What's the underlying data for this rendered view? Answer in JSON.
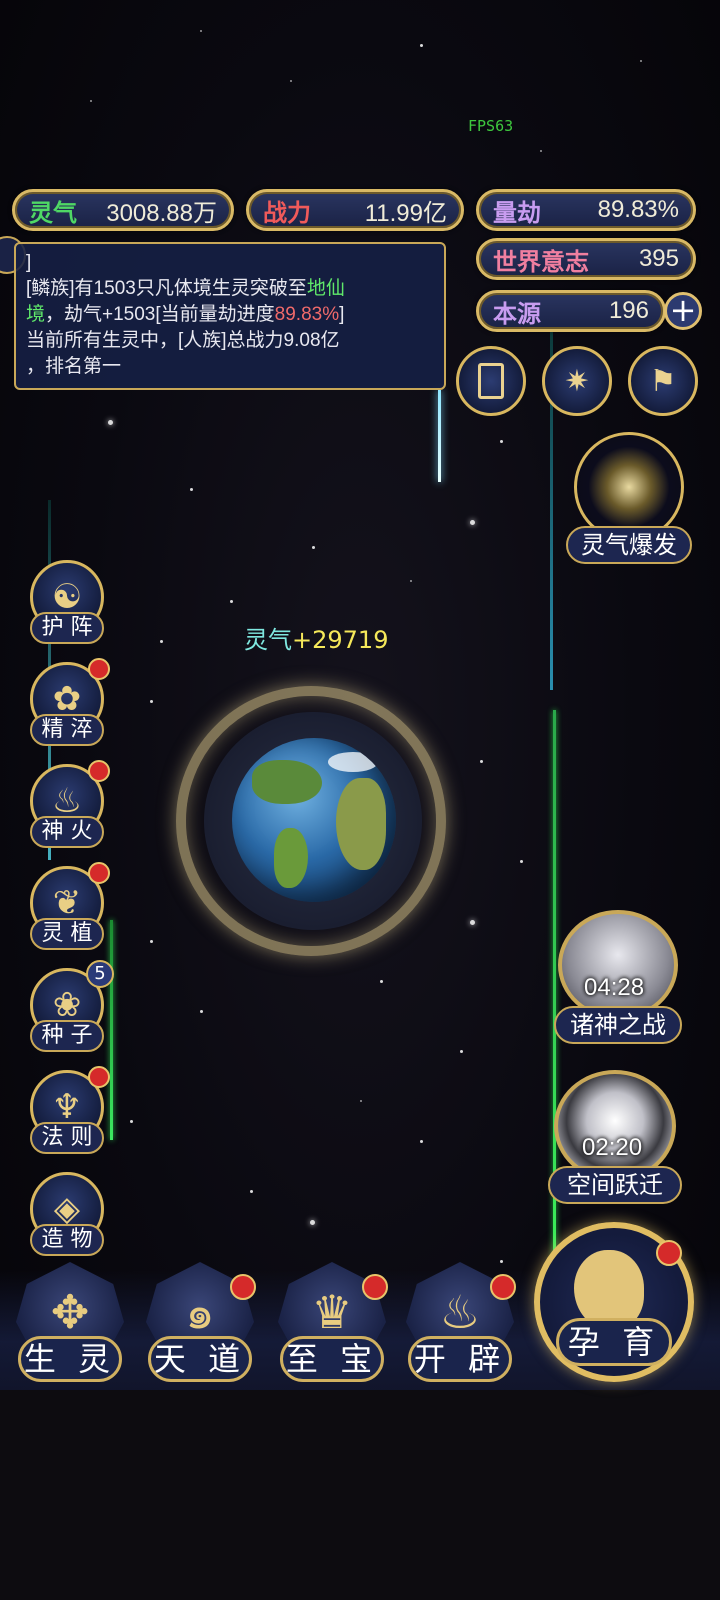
{
  "fps": "FPS63",
  "stats": {
    "lingqi": {
      "label": "灵气",
      "value": "3008.88万"
    },
    "zhanli": {
      "label": "战力",
      "value": "11.99亿"
    },
    "liangjie": {
      "label": "量劫",
      "value": "89.83%"
    },
    "shijie": {
      "label": "世界意志",
      "value": "395"
    },
    "benyuan": {
      "label": "本源",
      "value": "196"
    }
  },
  "log": {
    "line0": "]",
    "line1_a": "[鳞族]有1503只凡体境生灵突破至",
    "line1_b": "地仙",
    "line2_a": "境",
    "line2_b": "，劫气+1503[当前量劫进度",
    "line2_c": "89.83%",
    "line2_d": "]",
    "line3": "当前所有生灵中，[人族]总战力9.08亿",
    "line4": "，排名第一"
  },
  "gain": {
    "label": "灵气",
    "value": "+29719"
  },
  "side_buttons": [
    {
      "label": "护 阵",
      "icon": "yin-yang-icon"
    },
    {
      "label": "精 淬",
      "icon": "lotus-icon"
    },
    {
      "label": "神 火",
      "icon": "flame-icon"
    },
    {
      "label": "灵 植",
      "icon": "plant-icon"
    },
    {
      "label": "种 子",
      "icon": "seed-icon",
      "count": "5"
    },
    {
      "label": "法 则",
      "icon": "rule-icon"
    },
    {
      "label": "造 物",
      "icon": "creation-icon"
    }
  ],
  "burst": {
    "label": "灵气爆发"
  },
  "gods_war": {
    "label": "诸神之战",
    "timer": "04:28"
  },
  "space_jump": {
    "label": "空间跃迁",
    "timer": "02:20"
  },
  "bottom": {
    "shengling": "生 灵",
    "tiandao": "天 道",
    "zhibao": "至 宝",
    "kaipi": "开 辟",
    "yunyu": "孕 育"
  },
  "colors": {
    "gold": "#d9b965",
    "panel": "#1a2245",
    "green": "#5fe86a",
    "red": "#f06a6a",
    "notif": "#d52a2a"
  }
}
